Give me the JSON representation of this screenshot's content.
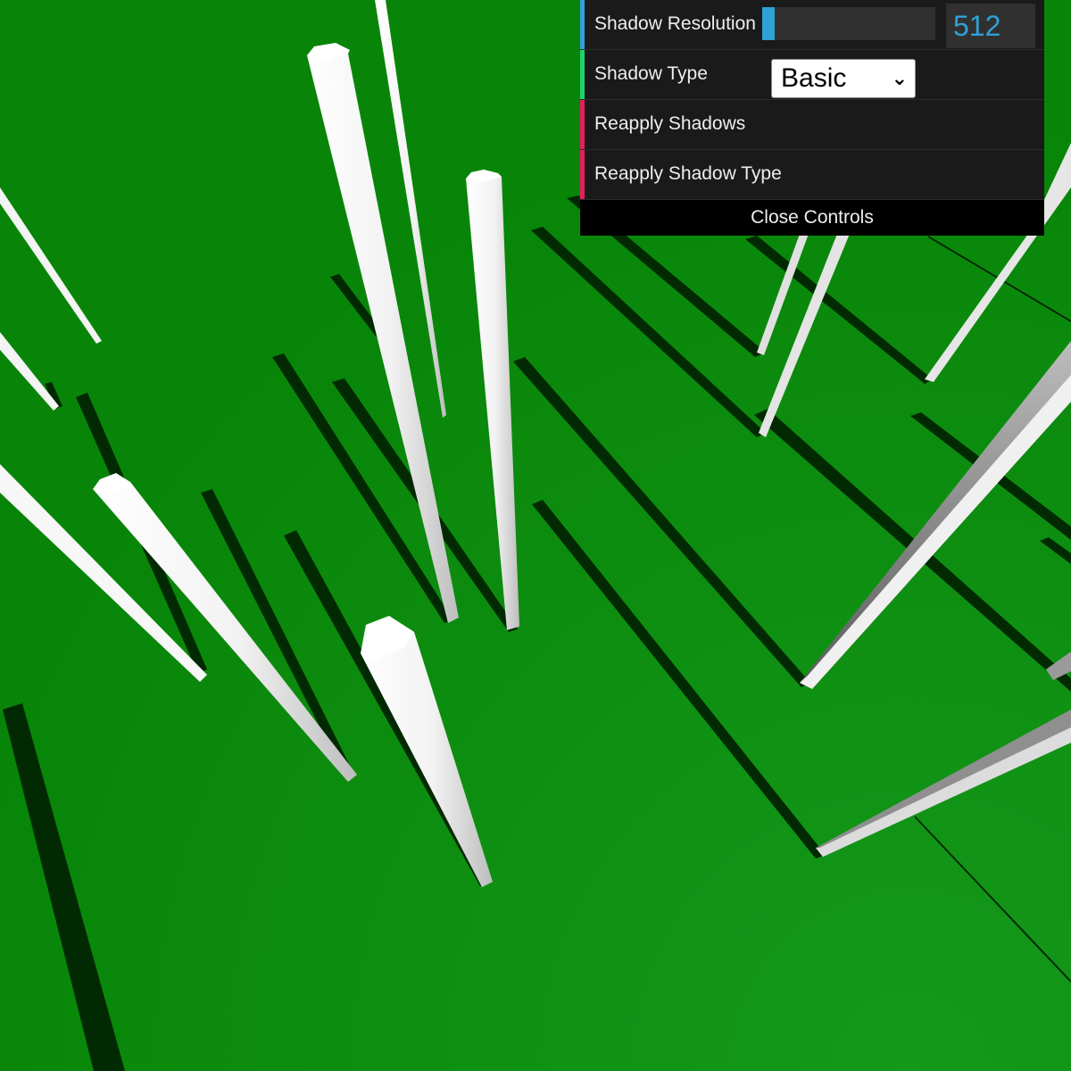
{
  "colors": {
    "ground": "#0a8a0a",
    "ground_light": "#13991a",
    "shadow": "#022a02",
    "panel_bg": "#1a1a1a",
    "number_accent": "#2fa1d6",
    "function_accent": "#e61d5f",
    "option_accent": "#1ed36f"
  },
  "gui": {
    "controls": [
      {
        "label": "Shadow Resolution",
        "kind": "slider",
        "value": "512",
        "fill_fraction": 0.07,
        "accent": "#2fa1d6"
      },
      {
        "label": "Shadow Type",
        "kind": "select",
        "selected": "Basic",
        "chevron_icon": "chevron-down-icon",
        "accent": "#1ed36f"
      },
      {
        "label": "Reapply Shadows",
        "kind": "button",
        "accent": "#e61d5f"
      },
      {
        "label": "Reapply Shadow Type",
        "kind": "button",
        "accent": "#e61d5f"
      }
    ],
    "close_label": "Close Controls"
  }
}
